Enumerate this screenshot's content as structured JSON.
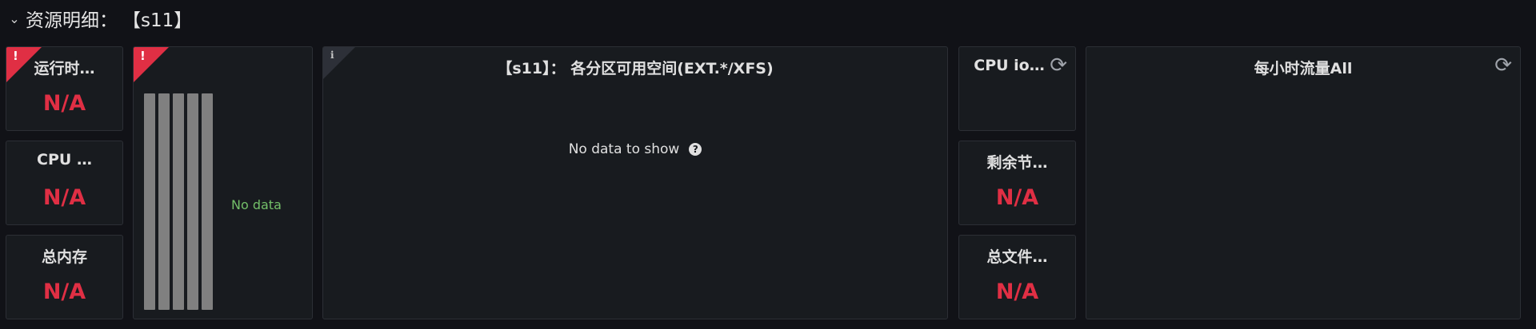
{
  "row": {
    "chevron": "⌄",
    "title": "资源明细：",
    "host": "【s11】"
  },
  "colors": {
    "background": "#111217",
    "panel": "#181b1f",
    "error": "#e02f44",
    "no_data_green": "#73bf69",
    "bar": "#808080"
  },
  "left_panels": [
    {
      "title": "运行时…",
      "value": "N/A",
      "error": true
    },
    {
      "title": "CPU …",
      "value": "N/A"
    },
    {
      "title": "总内存",
      "value": "N/A"
    }
  ],
  "bar_panel": {
    "error": true,
    "error_icon": "!",
    "no_data": "No data",
    "bar_count": 5
  },
  "partition_panel": {
    "title": "【s11】： 各分区可用空间(EXT.*/XFS)",
    "info_icon": "i",
    "message": "No data to show",
    "help_icon": "?"
  },
  "right_panels": [
    {
      "title": "CPU io…",
      "value": "",
      "icon": "refresh-icon"
    },
    {
      "title": "剩余节…",
      "value": "N/A"
    },
    {
      "title": "总文件…",
      "value": "N/A"
    }
  ],
  "traffic_panel": {
    "title": "每小时流量All",
    "icon": "refresh-icon"
  }
}
